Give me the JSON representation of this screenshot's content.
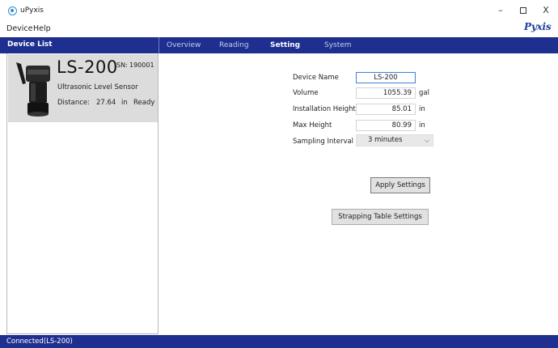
{
  "window": {
    "title": "uPyxis",
    "brand": "Pyxis",
    "min_glyph": "–",
    "close_glyph": "X"
  },
  "menu": {
    "items": [
      "Device",
      "Help"
    ]
  },
  "sidebar": {
    "title": "Device List",
    "device": {
      "model": "LS-200",
      "sn_label": "SN:",
      "sn": "190001",
      "type": "Ultrasonic Level Sensor",
      "distance_label": "Distance:",
      "distance_value": "27.64",
      "distance_unit": "in",
      "status": "Ready"
    }
  },
  "tabs": [
    "Overview",
    "Reading",
    "Setting",
    "System"
  ],
  "active_tab": "Setting",
  "settings": {
    "device_name": {
      "label": "Device Name",
      "value": "LS-200"
    },
    "volume": {
      "label": "Volume",
      "value": "1055.39",
      "unit": "gal"
    },
    "installation_height": {
      "label": "Installation Height",
      "value": "85.01",
      "unit": "in"
    },
    "max_height": {
      "label": "Max Height",
      "value": "80.99",
      "unit": "in"
    },
    "sampling_interval": {
      "label": "Sampling Interval",
      "value": "3 minutes"
    },
    "apply_button": "Apply Settings",
    "strapping_button": "Strapping Table Settings"
  },
  "status_bar": {
    "text": "Connected(LS-200)"
  },
  "colors": {
    "header_blue": "#1f2f8f",
    "brand_blue": "#1f3f9a",
    "focus_border": "#3b82d8"
  }
}
